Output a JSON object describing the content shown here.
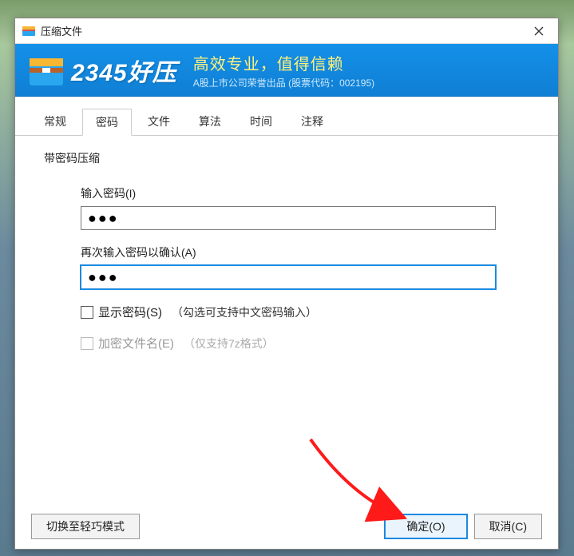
{
  "window": {
    "title": "压缩文件"
  },
  "banner": {
    "logo": "2345好压",
    "tagline": "高效专业，值得信赖",
    "sub": "A股上市公司荣誉出品 (股票代码：002195)"
  },
  "tabs": {
    "general": "常规",
    "password": "密码",
    "file": "文件",
    "algorithm": "算法",
    "time": "时间",
    "comment": "注释"
  },
  "fieldset": {
    "title": "带密码压缩"
  },
  "form": {
    "enter_label": "输入密码(I)",
    "enter_value": "●●●",
    "confirm_label": "再次输入密码以确认(A)",
    "confirm_value": "●●●",
    "show_label": "显示密码(S)",
    "show_hint": "（勾选可支持中文密码输入）",
    "encrypt_label": "加密文件名(E)",
    "encrypt_hint": "（仅支持7z格式）"
  },
  "footer": {
    "switch_mode": "切换至轻巧模式",
    "ok": "确定(O)",
    "cancel": "取消(C)"
  }
}
